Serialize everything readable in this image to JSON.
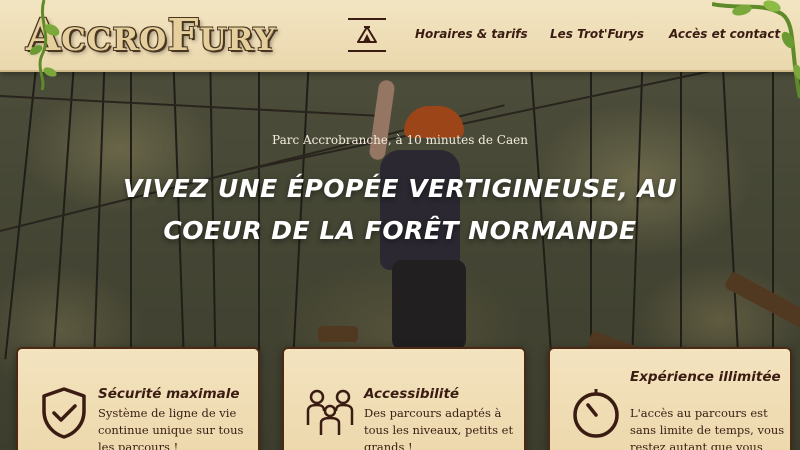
{
  "header": {
    "logo_text": "AccroFury",
    "nav": {
      "home_icon": "tent-icon",
      "items": [
        {
          "label": "Horaires & tarifs"
        },
        {
          "label": "Les Trot'Furys"
        },
        {
          "label": "Accès et contact"
        }
      ]
    }
  },
  "hero": {
    "tagline": "Parc Accrobranche, à 10 minutes de Caen",
    "title": "VIVEZ UNE ÉPOPÉE VERTIGINEUSE, AU COEUR DE LA FORÊT NORMANDE"
  },
  "features": [
    {
      "icon": "shield-check-icon",
      "title": "Sécurité maximale",
      "text": "Système de ligne de vie continue unique sur tous les parcours !"
    },
    {
      "icon": "family-icon",
      "title": "Accessibilité",
      "text": "Des parcours adaptés à tous les niveaux, petits et grands !"
    },
    {
      "icon": "timer-icon",
      "title": "Expérience illimitée",
      "text": "L'accès au parcours est sans limite de temps, vous restez autant que vous"
    }
  ],
  "colors": {
    "header_bg": "#f3e5c2",
    "text_dark": "#3a1c12",
    "card_border": "#4a2a14",
    "hero_text": "#ffffff"
  }
}
